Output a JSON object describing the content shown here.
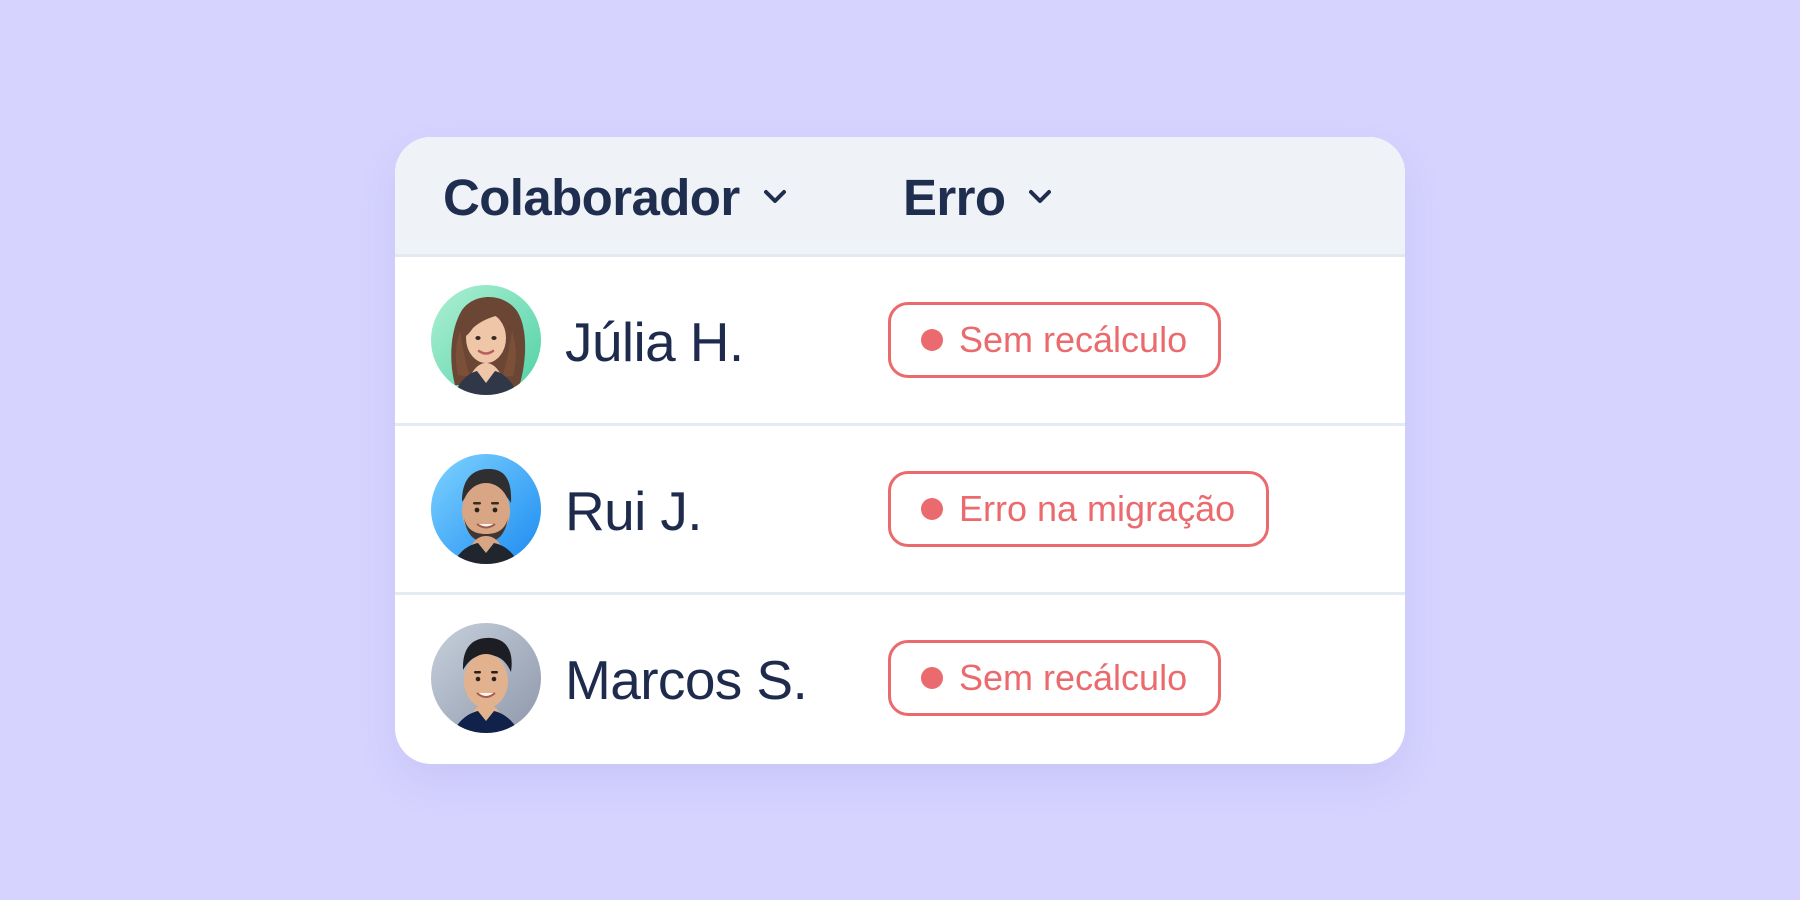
{
  "table": {
    "headers": {
      "collaborator": "Colaborador",
      "error": "Erro"
    },
    "rows": [
      {
        "name": "Júlia H.",
        "error": "Sem recálculo"
      },
      {
        "name": "Rui J.",
        "error": "Erro na migração"
      },
      {
        "name": "Marcos S.",
        "error": "Sem recálculo"
      }
    ]
  },
  "colors": {
    "page_background": "#d6d3ff",
    "card_background": "#ffffff",
    "header_background": "#eff3f8",
    "text": "#1f2d4f",
    "error": "#ea6a6d"
  },
  "icons": {
    "sort": "chevron-down-icon",
    "status": "status-dot-icon"
  }
}
